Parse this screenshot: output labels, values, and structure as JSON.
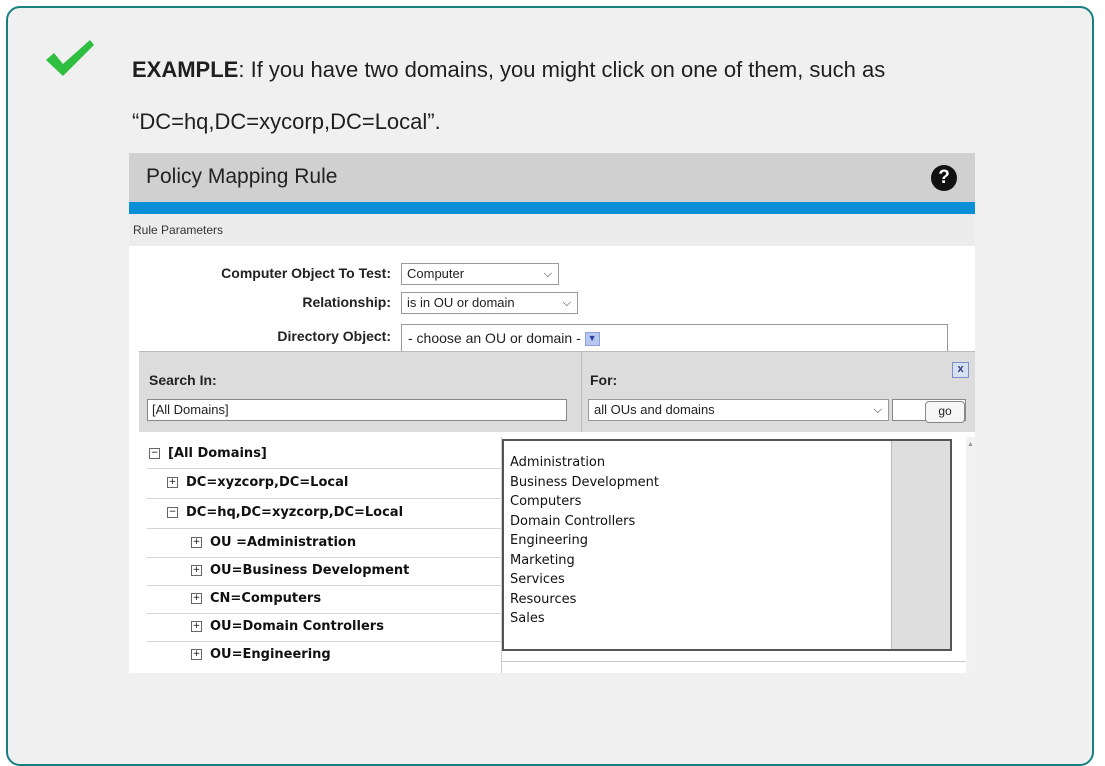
{
  "example": {
    "label": "EXAMPLE",
    "text": ": If you have two domains, you might click on one of them, such as",
    "text2": "“DC=hq,DC=xycorp,DC=Local”."
  },
  "window": {
    "title": "Policy Mapping Rule",
    "help_icon": "?",
    "section": "Rule Parameters"
  },
  "form": {
    "computer_object_label": "Computer Object To Test:",
    "computer_object_value": "Computer",
    "relationship_label": "Relationship:",
    "relationship_value": "is in OU or domain",
    "directory_object_label": "Directory Object:",
    "directory_object_value": "- choose an OU or domain -"
  },
  "picker": {
    "search_in_label": "Search In:",
    "search_in_value": "[All Domains]",
    "for_label": "For:",
    "for_value": "all OUs and domains",
    "go_label": "go",
    "close_icon": "x"
  },
  "tree": [
    {
      "label": "[All Domains]",
      "toggle": "−"
    },
    {
      "label": "DC=xyzcorp,DC=Local",
      "toggle": "+"
    },
    {
      "label": "DC=hq,DC=xyzcorp,DC=Local",
      "toggle": "−"
    },
    {
      "label": "OU =Administration",
      "toggle": "+"
    },
    {
      "label": "OU=Business Development",
      "toggle": "+"
    },
    {
      "label": "CN=Computers",
      "toggle": "+"
    },
    {
      "label": "OU=Domain Controllers",
      "toggle": "+"
    },
    {
      "label": "OU=Engineering",
      "toggle": "+"
    }
  ],
  "list": [
    "Administration",
    "Business Development",
    "Computers",
    "Domain Controllers",
    "Engineering",
    "Marketing",
    "Services",
    "Resources",
    "Sales"
  ],
  "colors": {
    "accent": "#0b8fd6",
    "border": "#1a7f7f",
    "check": "#2fbf40"
  }
}
